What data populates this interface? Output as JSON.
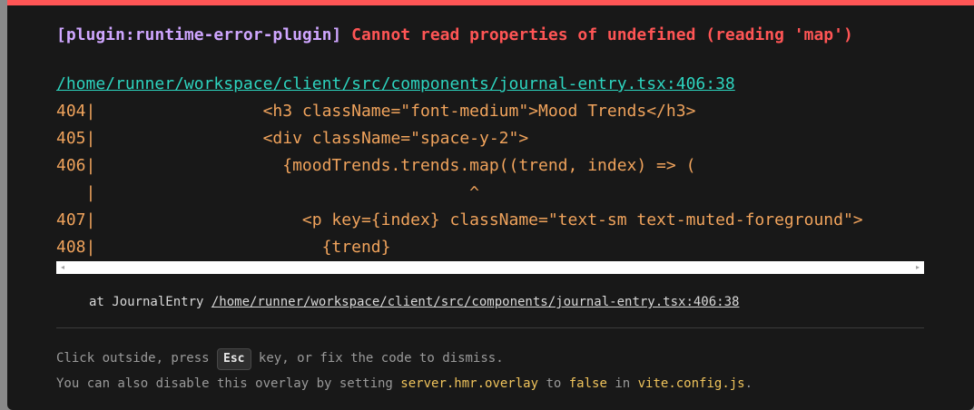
{
  "error": {
    "plugin": "[plugin:runtime-error-plugin]",
    "message": "Cannot read properties of undefined (reading 'map')"
  },
  "file_link": "/home/runner/workspace/client/src/components/journal-entry.tsx:406:38",
  "code_frame": {
    "lines": [
      "404|                 <h3 className=\"font-medium\">Mood Trends</h3>",
      "405|                 <div className=\"space-y-2\">",
      "406|                   {moodTrends.trends.map((trend, index) => (",
      "   |                                      ^",
      "407|                     <p key={index} className=\"text-sm text-muted-foreground\">",
      "408|                       {trend}"
    ]
  },
  "scrollbar": {
    "left_arrow": "◂",
    "right_arrow": "▸"
  },
  "stack": {
    "prefix": "at JournalEntry ",
    "link": "/home/runner/workspace/client/src/components/journal-entry.tsx:406:38"
  },
  "tips": {
    "line1_before": "Click outside, press ",
    "key": "Esc",
    "line1_after": " key, or fix the code to dismiss.",
    "line2_a": "You can also disable this overlay by setting ",
    "line2_b": "server.hmr.overlay",
    "line2_c": " to ",
    "line2_d": "false",
    "line2_e": " in ",
    "line2_f": "vite.config.js",
    "line2_g": "."
  },
  "colors": {
    "accent_error": "#ff5555",
    "plugin": "#cfa6ff",
    "link": "#2dd4bf",
    "code": "#f0a35c",
    "config": "#f0c45c"
  }
}
